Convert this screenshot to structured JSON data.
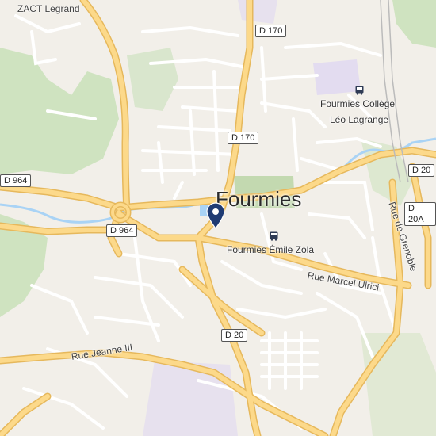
{
  "map": {
    "city": "Fourmies",
    "places": {
      "zact": "ZACT Legrand"
    },
    "pois": {
      "college_line1": "Fourmies Collège",
      "college_line2": "Léo Lagrange",
      "zola": "Fourmies Émile Zola"
    },
    "roads": {
      "d170_top": "D 170",
      "d170_mid": "D 170",
      "d964_left": "D 964",
      "d964_mid": "D 964",
      "d20_right": "D 20",
      "d20a_right": "D 20A",
      "d20_south": "D 20"
    },
    "streets": {
      "marcel_ulrici": "Rue Marcel Ulrici",
      "jeanne_iii": "Rue Jeanne III",
      "grenoble": "Rue de Grenoble"
    },
    "icons": {
      "marker": "map-pin-icon",
      "bus": "bus-stop-icon"
    },
    "colors": {
      "background": "#f2efe9",
      "major_road": "#fcd98a",
      "minor_road": "#ffffff",
      "forest": "#cfe3c0",
      "water": "#a9d3f5",
      "marker": "#1f3b73"
    }
  }
}
